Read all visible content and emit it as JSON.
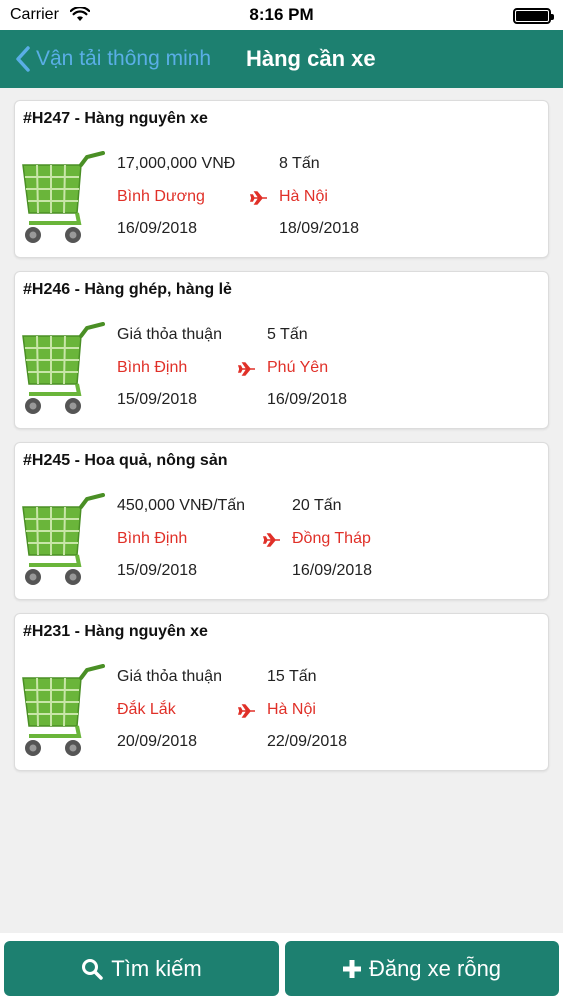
{
  "status_bar": {
    "carrier": "Carrier",
    "time": "8:16 PM"
  },
  "nav": {
    "back_label": "Vận tải thông minh",
    "title": "Hàng cần xe"
  },
  "cards": [
    {
      "title": "#H247 - Hàng nguyên xe",
      "price": "17,000,000 VNĐ",
      "weight": "8 Tấn",
      "origin": "Bình Dương",
      "destination": "Hà Nội",
      "date_from": "16/09/2018",
      "date_to": "18/09/2018"
    },
    {
      "title": "#H246 - Hàng ghép, hàng lẻ",
      "price": "Giá thỏa thuận",
      "weight": "5 Tấn",
      "origin": "Bình Định",
      "destination": "Phú Yên",
      "date_from": "15/09/2018",
      "date_to": "16/09/2018"
    },
    {
      "title": "#H245 - Hoa quả, nông sản",
      "price": "450,000 VNĐ/Tấn",
      "weight": "20 Tấn",
      "origin": "Bình Định",
      "destination": "Đồng Tháp",
      "date_from": "15/09/2018",
      "date_to": "16/09/2018"
    },
    {
      "title": "#H231 - Hàng nguyên xe",
      "price": "Giá thỏa thuận",
      "weight": "15 Tấn",
      "origin": "Đắk Lắk",
      "destination": "Hà Nội",
      "date_from": "20/09/2018",
      "date_to": "22/09/2018"
    }
  ],
  "bottom": {
    "search_label": "Tìm kiếm",
    "post_label": "Đăng xe rỗng"
  },
  "colors": {
    "primary": "#1d8070",
    "back_link": "#5aaee6",
    "location_red": "#e03028",
    "cart_green": "#6ab53a"
  },
  "icons": {
    "back": "chevron-left-icon",
    "cart": "shopping-cart-icon",
    "route": "airplane-icon",
    "search": "search-icon",
    "add": "plus-icon"
  }
}
